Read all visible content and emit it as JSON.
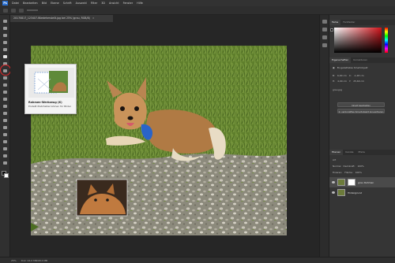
{
  "menubar": {
    "items": [
      "Datei",
      "Bearbeiten",
      "Bild",
      "Ebene",
      "Schrift",
      "Auswahl",
      "Filter",
      "3D",
      "Ansicht",
      "Fenster",
      "Hilfe"
    ]
  },
  "document": {
    "tab_title": "20170817_123407-Wiedeherstellt.jpg bei 25% (grau, RGB/8)",
    "close_glyph": "×"
  },
  "toolbar": {
    "active_tool": "frame-tool"
  },
  "tooltip": {
    "title": "Rahmen-Werkzeug (K)",
    "description": "Erstellt Platzhalterrahmen für Bilder"
  },
  "statusbar": {
    "zoom": "25%",
    "info": "Dok: 24,0 MB/48,0 MB"
  },
  "color_panel": {
    "tabs": [
      "Farbe",
      "Farbfelder"
    ],
    "accent": "#d0131a"
  },
  "properties_panel": {
    "tabs": [
      "Eigenschaften",
      "Korrekturen"
    ],
    "type_label": "Eingebettetes Smartobjekt",
    "w_label": "B:",
    "w_value": "6,00 cm",
    "x_label": "X:",
    "x_value": "-1,28 cm",
    "h_label": "H:",
    "h_value": "4,00 cm",
    "y_label": "Y:",
    "y_value": "25,60 cm",
    "content_label": "grau.jpg",
    "button_edit": "Inhalt bearbeiten",
    "button_convert": "In verknüpftes Smartobjekt konvertieren"
  },
  "layers_panel": {
    "tabs": [
      "Ebenen",
      "Kanäle",
      "Pfade"
    ],
    "kind_label": "Art",
    "blend_mode": "Normal",
    "opacity_label": "Deckkraft:",
    "opacity_value": "100%",
    "lock_label": "Fixieren:",
    "fill_label": "Fläche:",
    "fill_value": "100%",
    "layers": [
      {
        "name": "grau Rahmen",
        "selected": true
      },
      {
        "name": "Hintergrund",
        "selected": false
      }
    ]
  }
}
